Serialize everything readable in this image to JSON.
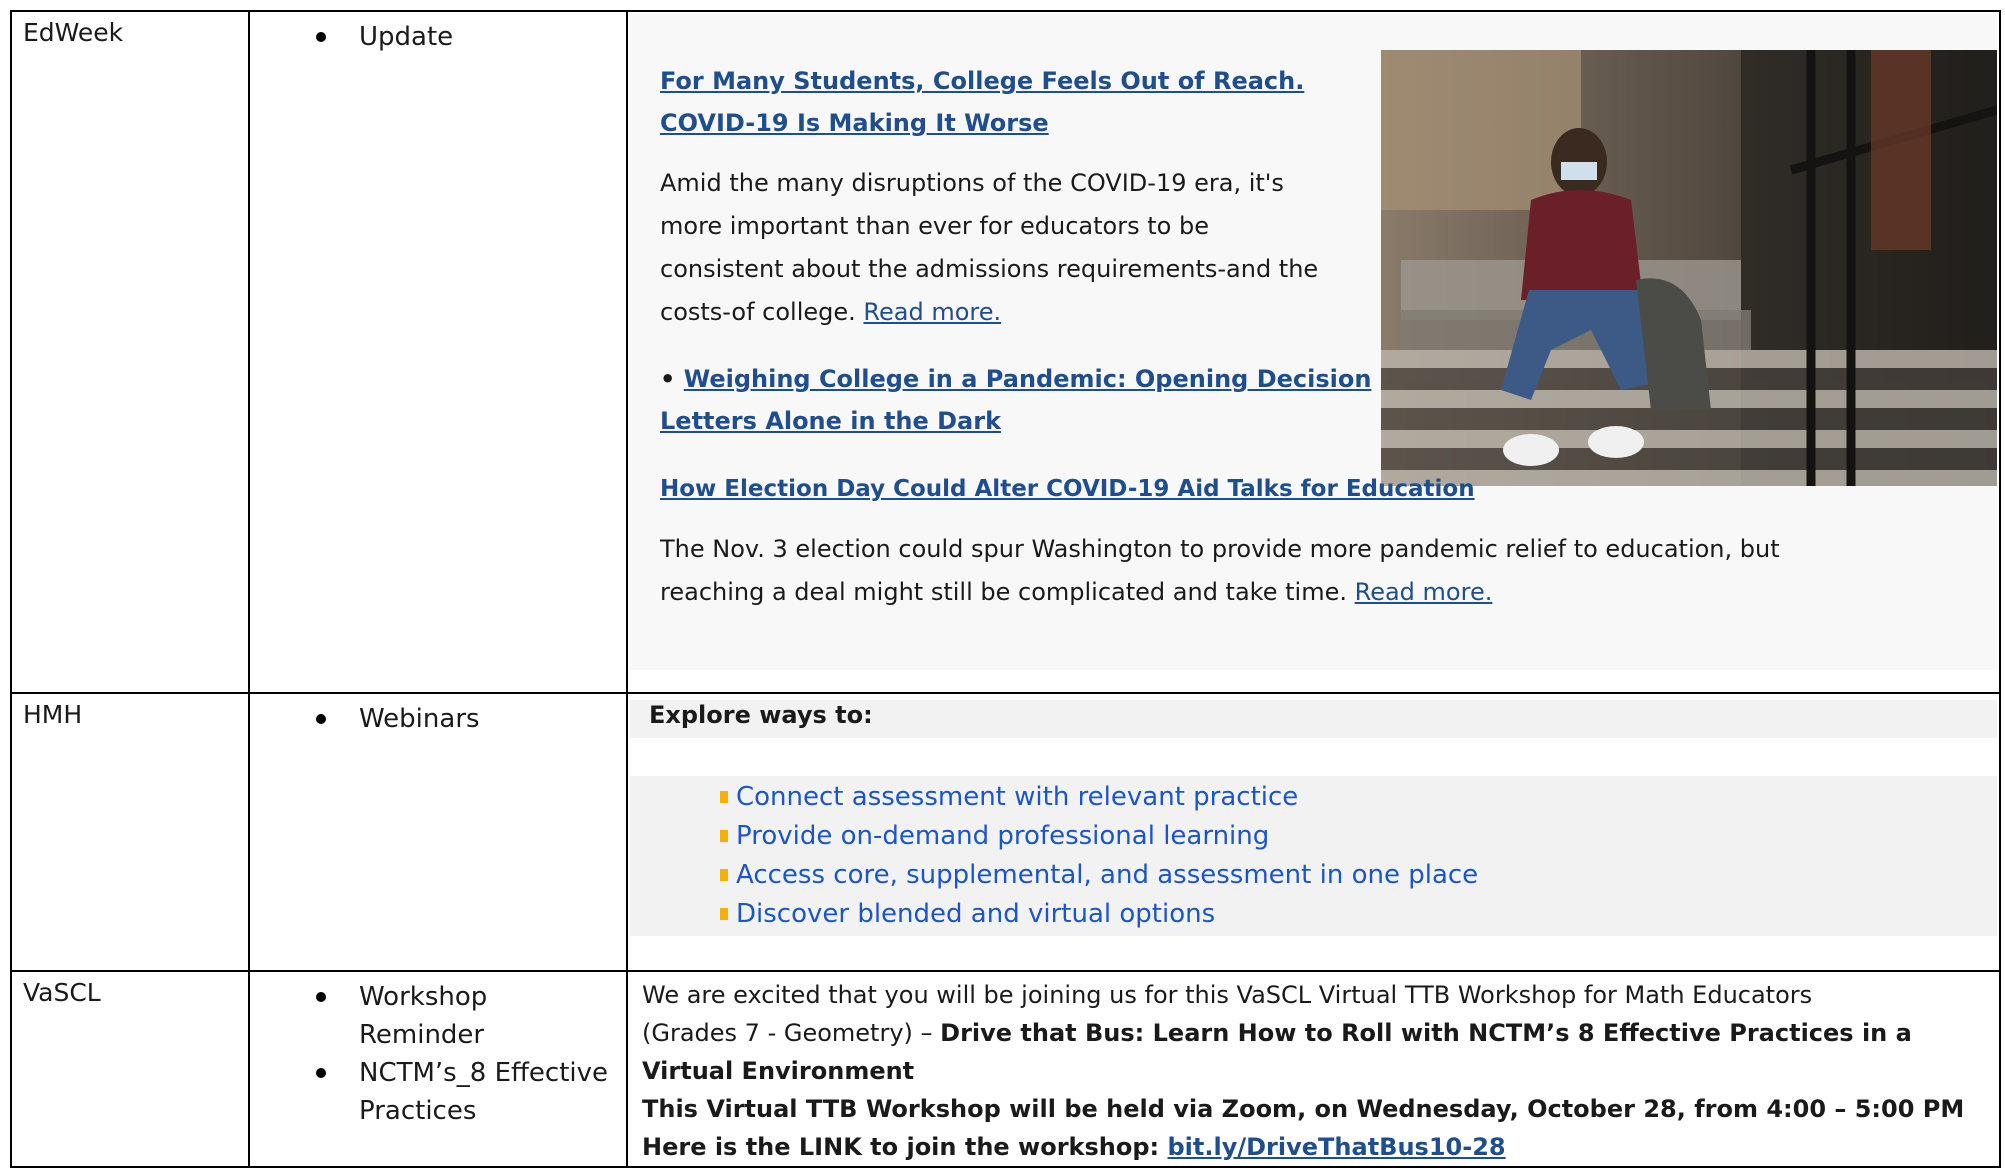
{
  "rows": [
    {
      "org": "EdWeek",
      "bullets": [
        "Update"
      ]
    },
    {
      "org": "HMH",
      "bullets": [
        "Webinars"
      ]
    },
    {
      "org": "VaSCL",
      "bullets": [
        "Workshop Reminder",
        "NCTM’s_8 Effective Practices"
      ]
    }
  ],
  "edweek": {
    "article1_title_line1": "For Many Students, College Feels Out of Reach.",
    "article1_title_line2": "COVID-19 Is Making It Worse",
    "article1_body_l1": "Amid the many disruptions of the COVID-19 era, it's",
    "article1_body_l2": "more important than ever for educators to be",
    "article1_body_l3": "consistent about the admissions requirements-and the",
    "article1_body_l4": "costs-of college.",
    "read_more": "Read more.",
    "bullet_glyph": "•",
    "related_l1": "Weighing College in a Pandemic: Opening Decision",
    "related_l2": "Letters Alone in the Dark",
    "article2_title": "How Election Day Could Alter COVID-19 Aid Talks for Education",
    "article2_body_l1": "The Nov. 3 election could spur Washington to provide more pandemic relief to education, but",
    "article2_body_l2": "reaching a deal might still be complicated and take time."
  },
  "hmh": {
    "heading": "Explore ways to:",
    "items": [
      "Connect assessment with relevant practice",
      "Provide on-demand professional learning",
      "Access core, supplemental, and assessment in one place",
      "Discover blended and virtual options"
    ]
  },
  "vascl": {
    "l1": "We are excited that you will be joining us for this VaSCL Virtual TTB Workshop for Math Educators",
    "l2_normal": "(Grades 7 - Geometry) – ",
    "l2_bold": "Drive that Bus: Learn How to Roll with NCTM’s 8 Effective Practices in a",
    "l3_bold": "Virtual Environment",
    "l4_bold": "This Virtual TTB Workshop will be held via Zoom, on Wednesday, October 28, from 4:00 – 5:00 PM",
    "l5_bold": "Here is the LINK to join the workshop: ",
    "link": "bit.ly/DriveThatBus10-28"
  },
  "colors": {
    "link": "#1f4e8f",
    "hmh_item": "#1a56c8",
    "hmh_square": "#f5b10a",
    "panel_bg": "#f2f2f2"
  }
}
